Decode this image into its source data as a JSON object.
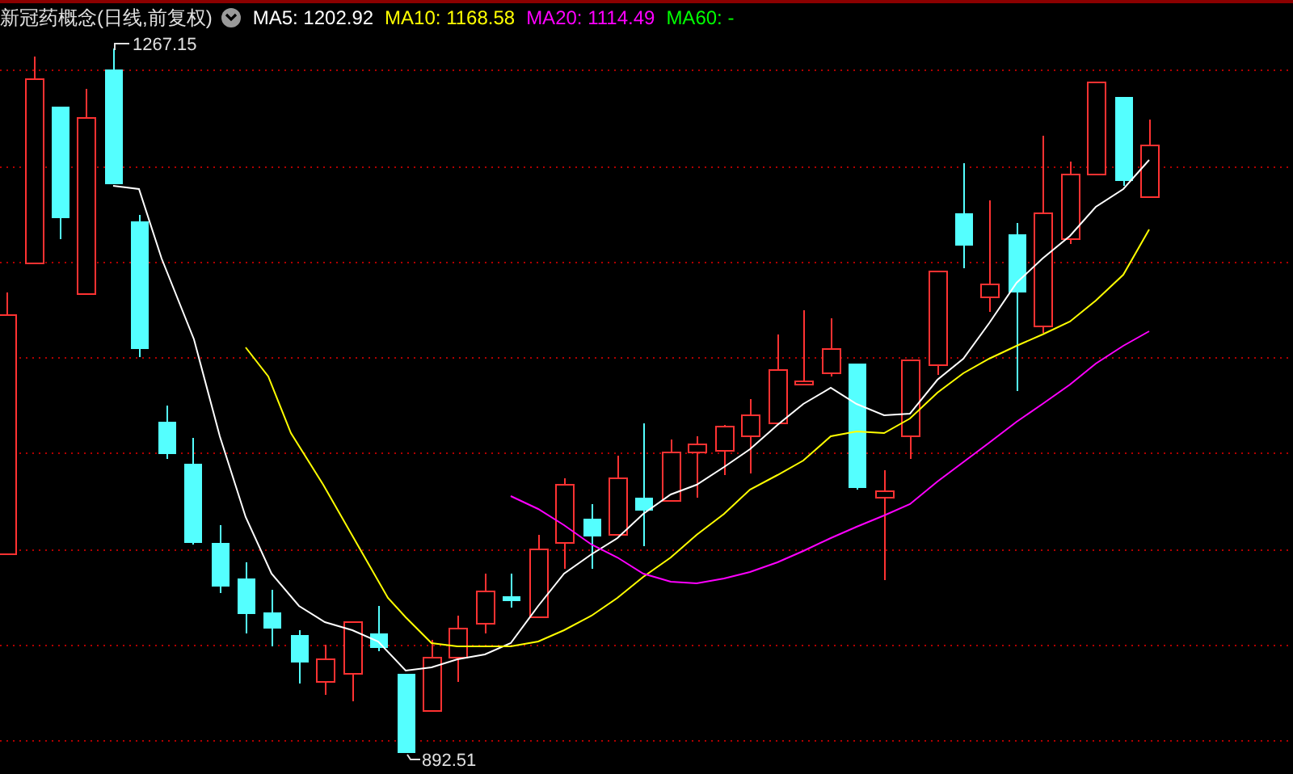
{
  "header": {
    "title": "新冠药概念(日线,前复权)",
    "indicators": [
      {
        "label": "MA5: 1202.92",
        "color": "#ffffff"
      },
      {
        "label": "MA10: 1168.58",
        "color": "#ffff00"
      },
      {
        "label": "MA20: 1114.49",
        "color": "#ff00ff"
      },
      {
        "label": "MA60: -",
        "color": "#00ff00"
      }
    ]
  },
  "chart": {
    "high_marker": "1267.15",
    "low_marker": "892.51"
  }
}
